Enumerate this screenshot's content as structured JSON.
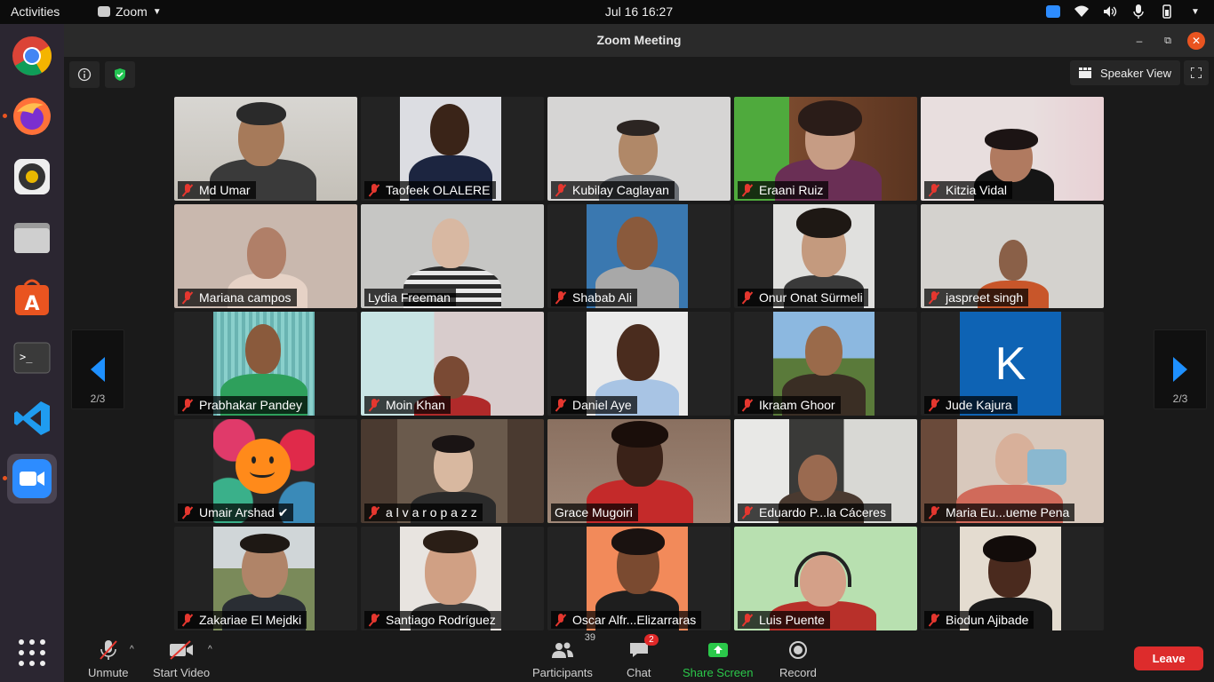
{
  "topbar": {
    "activities": "Activities",
    "app_name": "Zoom",
    "clock": "Jul 16  16:27"
  },
  "window": {
    "title": "Zoom Meeting",
    "speaker_view": "Speaker View"
  },
  "pager": {
    "left": "2/3",
    "right": "2/3"
  },
  "participants": [
    {
      "name": "Md Umar"
    },
    {
      "name": "Taofeek OLALERE"
    },
    {
      "name": "Kubilay Caglayan"
    },
    {
      "name": "Eraani Ruiz"
    },
    {
      "name": "Kitzia Vidal"
    },
    {
      "name": "Mariana campos"
    },
    {
      "name": "Lydia Freeman"
    },
    {
      "name": "Shabab Ali"
    },
    {
      "name": "Onur Onat Sürmeli"
    },
    {
      "name": "jaspreet singh"
    },
    {
      "name": "Prabhakar Pandey"
    },
    {
      "name": "Moin Khan"
    },
    {
      "name": "Daniel Aye"
    },
    {
      "name": "Ikraam Ghoor"
    },
    {
      "name": "Jude Kajura",
      "initial": "K"
    },
    {
      "name": "Umair Arshad ✔"
    },
    {
      "name": "a l v a r o p a z z"
    },
    {
      "name": "Grace Mugoiri"
    },
    {
      "name": "Eduardo P...la Cáceres"
    },
    {
      "name": "Maria Eu...ueme Pena"
    },
    {
      "name": "Zakariae El Mejdki"
    },
    {
      "name": "Santiago Rodríguez"
    },
    {
      "name": "Oscar Alfr...Elizarraras"
    },
    {
      "name": "Luis Puente"
    },
    {
      "name": "Biodun Ajibade"
    }
  ],
  "toolbar": {
    "unmute": "Unmute",
    "start_video": "Start Video",
    "participants": "Participants",
    "participants_count": "39",
    "chat": "Chat",
    "chat_badge": "2",
    "share_screen": "Share Screen",
    "record": "Record",
    "leave": "Leave"
  },
  "colors": {
    "share_green": "#2bc84a",
    "leave_red": "#dd2c2c",
    "pager_blue": "#1e90ff",
    "active_outline": "#2bc84a",
    "muted_red": "#e5372f"
  }
}
